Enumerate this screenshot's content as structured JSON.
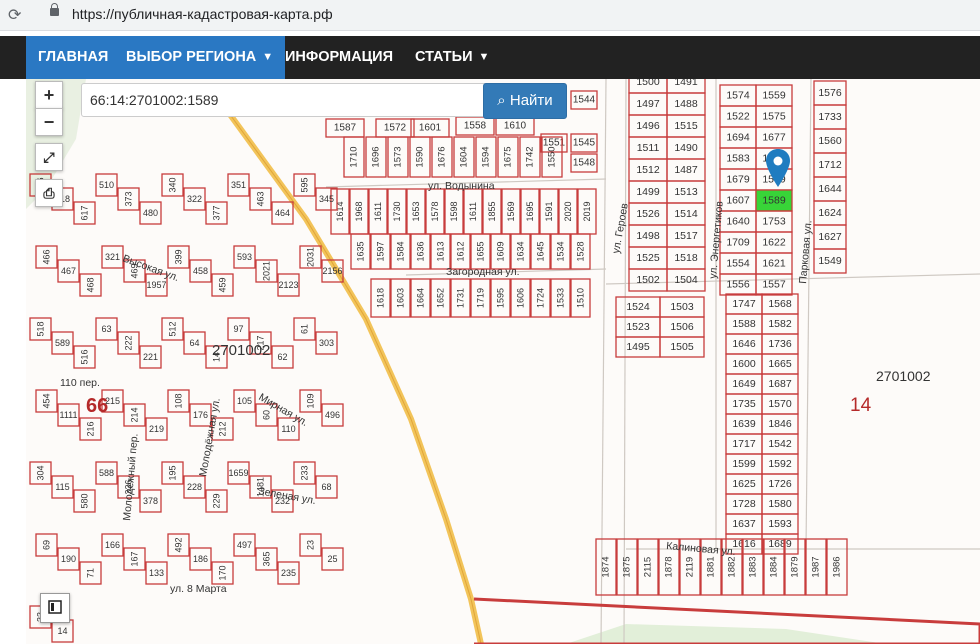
{
  "browser": {
    "url": "https://публичная-кадастровая-карта.рф",
    "reload_icon": "reload-icon",
    "lock_icon": "lock-icon"
  },
  "nav": {
    "home": "ГЛАВНАЯ",
    "region": "ВЫБОР РЕГИОНА",
    "info": "ИНФОРМАЦИЯ",
    "articles": "СТАТЬИ"
  },
  "search": {
    "value": "66:14:2701002:1589",
    "button": "Найти"
  },
  "controls": {
    "zoom_in": "+",
    "zoom_out": "−"
  },
  "colors": {
    "parcel": "#c83c3c",
    "selected": "#38d438",
    "pin": "#1f7cc0",
    "road": "#f2c45a",
    "nav_active": "#2a78c3"
  },
  "map": {
    "big_labels": [
      {
        "text": "2701002"
      },
      {
        "text": "66"
      },
      {
        "text": "2701002"
      },
      {
        "text": "14"
      }
    ],
    "streets": [
      "ул. Водынина",
      "Загородная ул.",
      "ул. Героев",
      "ул. Энергетиков",
      "Парковая ул.",
      "Высокая ул.",
      "Мирная ул.",
      "Зеленая ул.",
      "Молодёжная ул.",
      "Молодежный пер.",
      "110 пер.",
      "ул. 8 Марта",
      "Калиновая ул."
    ],
    "grid_right": [
      [
        "1574",
        "1559"
      ],
      [
        "1522",
        "1575"
      ],
      [
        "1694",
        "1677"
      ],
      [
        "1583",
        "1658"
      ],
      [
        "1679",
        "1589"
      ],
      [
        "1607",
        "1589"
      ],
      [
        "1640",
        "1753"
      ],
      [
        "1709",
        "1622"
      ],
      [
        "1554",
        "1621"
      ],
      [
        "1556",
        "1557"
      ]
    ],
    "grid_mid": [
      [
        "1500",
        "1491"
      ],
      [
        "1497",
        "1488"
      ],
      [
        "1496",
        "1515"
      ],
      [
        "1511",
        "1490"
      ],
      [
        "1512",
        "1487"
      ],
      [
        "1499",
        "1513"
      ],
      [
        "1526",
        "1514"
      ],
      [
        "1498",
        "1517"
      ],
      [
        "1525",
        "1518"
      ],
      [
        "1502",
        "1504"
      ]
    ],
    "grid_lower": [
      [
        "1747",
        "1568"
      ],
      [
        "1588",
        "1582"
      ],
      [
        "1646",
        "1736"
      ],
      [
        "1600",
        "1665"
      ],
      [
        "1649",
        "1687"
      ],
      [
        "1735",
        "1570"
      ],
      [
        "1639",
        "1846"
      ],
      [
        "1717",
        "1542"
      ],
      [
        "1599",
        "1592"
      ],
      [
        "1625",
        "1726"
      ],
      [
        "1728",
        "1580"
      ],
      [
        "1637",
        "1593"
      ],
      [
        "1616",
        "1689"
      ]
    ],
    "grid_small": [
      [
        "1524",
        "1503"
      ],
      [
        "1523",
        "1506"
      ],
      [
        "1495",
        "1505"
      ]
    ],
    "row_top": [
      "1587",
      "1572",
      "1601",
      "1558",
      "1610",
      "1551",
      "1544",
      "1545",
      "1548"
    ],
    "row_top_v": [
      "1710",
      "1696",
      "1573",
      "1590",
      "1676",
      "1604",
      "1594",
      "1675",
      "1742",
      "1550"
    ],
    "row_mid_v": [
      "1614",
      "1968",
      "1611",
      "1730",
      "1653",
      "1578",
      "1598",
      "1611",
      "1855",
      "1569",
      "1695",
      "1591",
      "2020",
      "2019"
    ],
    "row_mid2_v": [
      "1635",
      "1597",
      "1584",
      "1636",
      "1613",
      "1612",
      "1655",
      "1609",
      "1634",
      "1645",
      "1534",
      "1528"
    ],
    "row_low_v": [
      "1618",
      "1603",
      "1664",
      "1652",
      "1731",
      "1719",
      "1595",
      "1606",
      "1724",
      "1533",
      "1510"
    ],
    "right_col": [
      "1576",
      "1733",
      "1560",
      "1712",
      "1644",
      "1624",
      "1627",
      "1549"
    ],
    "bottom_row": [
      "1874",
      "1875",
      "2115",
      "1878",
      "2119",
      "1881",
      "1882",
      "1883",
      "1884",
      "1879",
      "1987",
      "1986"
    ],
    "west_labels": [
      "616",
      "618",
      "617",
      "510",
      "373",
      "480",
      "340",
      "322",
      "377",
      "351",
      "463",
      "464",
      "595",
      "345",
      "466",
      "467",
      "468",
      "321",
      "469",
      "1957",
      "399",
      "458",
      "459",
      "593",
      "2021",
      "2123",
      "2031",
      "2156",
      "518",
      "589",
      "516",
      "63",
      "222",
      "221",
      "512",
      "64",
      "14",
      "97",
      "217",
      "62",
      "61",
      "303",
      "454",
      "1111",
      "216",
      "215",
      "214",
      "219",
      "108",
      "176",
      "212",
      "105",
      "60",
      "110",
      "109",
      "496",
      "304",
      "115",
      "580",
      "588",
      "336",
      "378",
      "195",
      "228",
      "229",
      "1659",
      "1481",
      "232",
      "233",
      "68",
      "69",
      "190",
      "71",
      "166",
      "167",
      "133",
      "492",
      "186",
      "170",
      "497",
      "365",
      "235",
      "23",
      "25",
      "33",
      "14"
    ]
  }
}
